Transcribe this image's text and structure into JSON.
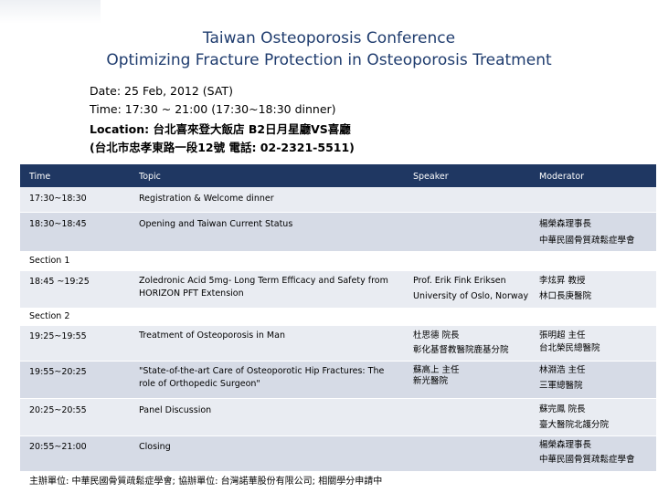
{
  "title_line1": "Taiwan Osteoporosis Conference",
  "title_line2": "Optimizing Fracture  Protection in Osteoporosis Treatment",
  "date": "Date: 25 Feb, 2012 (SAT)",
  "time": "Time: 17:30 ~ 21:00 (17:30~18:30 dinner)",
  "location": "Location:  台北喜來登大飯店 B2日月星廳VS喜廳",
  "address": "(台北市忠孝東路一段12號 電話: 02-2321-5511)",
  "table": {
    "headers": {
      "time": "Time",
      "topic": "Topic",
      "speaker": "Speaker",
      "moderator": "Moderator"
    },
    "rows": [
      {
        "time": "17:30~18:30",
        "topic": "Registration & Welcome dinner",
        "speaker": "",
        "moderator": "",
        "moderator2": ""
      },
      {
        "time": "18:30~18:45",
        "topic": "Opening  and Taiwan Current Status",
        "speaker": "",
        "moderator": "楊榮森理事長",
        "moderator2": "中華民國骨質疏鬆症學會"
      },
      {
        "section": "Section 1"
      },
      {
        "time": "18:45 ~19:25",
        "topic": "Zoledronic Acid 5mg- Long Term Efficacy and Safety from HORIZON PFT Extension",
        "speaker": "Prof. Erik Fink Eriksen",
        "speaker2": "University of Oslo, Norway",
        "moderator": "李炫昇 教授",
        "moderator2": "林口長庚醫院"
      },
      {
        "section": "Section 2"
      },
      {
        "time": "19:25~19:55",
        "topic": "Treatment of Osteoporosis in Man",
        "speaker": "杜思德 院長",
        "speaker2": "彰化基督教醫院鹿基分院",
        "moderator": "張明超 主任",
        "moderator2": "台北榮民總醫院"
      },
      {
        "time": "19:55~20:25",
        "topic": "\"State-of-the-art Care of Osteoporotic Hip Fractures: The role of Orthopedic Surgeon\"",
        "speaker": "蘇高上 主任",
        "speaker2": "新光醫院",
        "moderator": "林淵浩 主任",
        "moderator2": "三軍總醫院"
      },
      {
        "time": "20:25~20:55",
        "topic": "Panel Discussion",
        "speaker": "",
        "moderator": "蘇完鳳  院長",
        "moderator2": "臺大醫院北護分院"
      },
      {
        "time": "20:55~21:00",
        "topic": "Closing",
        "speaker": "",
        "moderator": "楊榮森理事長",
        "moderator2": "中華民國骨質疏鬆症學會"
      }
    ]
  },
  "footer": "主辦單位: 中華民國骨質疏鬆症學會; 協辦單位: 台灣諾華股份有限公司; 相關學分申請中"
}
